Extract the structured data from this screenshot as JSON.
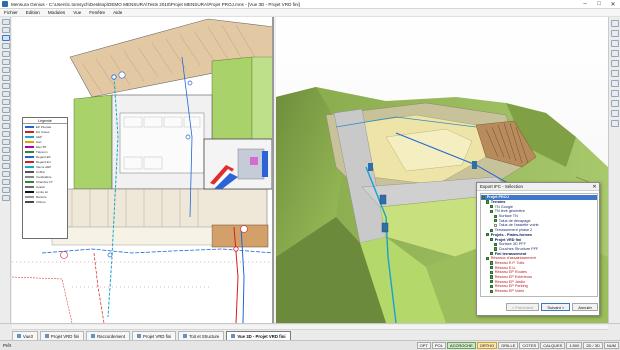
{
  "window": {
    "title": "Mensura Genius - C:\\Users\\c.tomsych\\Desktop\\DEMO MENSURA\\Tests 2018\\Projet MENSURA\\Projet PROJ.mns - [Vue 3D - Projet VRD fini]",
    "min": "–",
    "max": "□",
    "close": "✕"
  },
  "menu": [
    "Fichier",
    "Edition",
    "Modules",
    "Vue",
    "Fenêtre",
    "Aide",
    "Fenêtre"
  ],
  "legend": {
    "title": "Légende",
    "rows": [
      {
        "label": "EP Pluviale",
        "color": "#1e66d6"
      },
      {
        "label": "EU Usées",
        "color": "#d21f1f"
      },
      {
        "label": "AEP",
        "color": "#17a7c9"
      },
      {
        "label": "Gaz",
        "color": "#e0a000"
      },
      {
        "label": "Elec BT",
        "color": "#b000b0"
      },
      {
        "label": "Télécom",
        "color": "#2f8a2f"
      },
      {
        "label": "Regard EP",
        "color": "#1e66d6"
      },
      {
        "label": "Regard EU",
        "color": "#d21f1f"
      },
      {
        "label": "Vanne AEP",
        "color": "#17a7c9"
      },
      {
        "label": "Coffret",
        "color": "#555555"
      },
      {
        "label": "Candélabre",
        "color": "#888888"
      },
      {
        "label": "Chambre FT",
        "color": "#2f8a2f"
      },
      {
        "label": "Avaloir",
        "color": "#6b6b6b"
      },
      {
        "label": "Limite lot",
        "color": "#111111"
      },
      {
        "label": "Bordure",
        "color": "#9a9a9a"
      },
      {
        "label": "Clôture",
        "color": "#4a4a4a"
      }
    ]
  },
  "export_dialog": {
    "title": "Export IFC - Sélection",
    "close": "✕",
    "tree": [
      {
        "label": "Projet PROJ",
        "kind": "head",
        "indent": 0,
        "checked": true
      },
      {
        "label": "Terrains",
        "kind": "grp",
        "indent": 1,
        "checked": true
      },
      {
        "label": "TN Google",
        "kind": "node",
        "indent": 2,
        "checked": true
      },
      {
        "label": "TN levé géomètre",
        "kind": "node",
        "indent": 2,
        "checked": true
      },
      {
        "label": "Surface TN",
        "kind": "node",
        "indent": 3,
        "checked": true
      },
      {
        "label": "Talus de décapage",
        "kind": "node",
        "indent": 3,
        "checked": true
      },
      {
        "label": "Talus de l'assiette voirie",
        "kind": "node",
        "indent": 3,
        "checked": false
      },
      {
        "label": "Terrassement phase 2",
        "kind": "node",
        "indent": 2,
        "checked": true
      },
      {
        "label": "Projets - Plates-formes",
        "kind": "grp",
        "indent": 1,
        "checked": true
      },
      {
        "label": "Projet VRD fini",
        "kind": "grp",
        "indent": 2,
        "checked": true
      },
      {
        "label": "Surface 3D PFF",
        "kind": "node",
        "indent": 3,
        "checked": true
      },
      {
        "label": "Couches Structure PFF",
        "kind": "node",
        "indent": 3,
        "checked": true
      },
      {
        "label": "Fini terrassement",
        "kind": "grp",
        "indent": 2,
        "checked": true
      },
      {
        "label": "Réseaux d'assainissement",
        "kind": "red",
        "indent": 1,
        "checked": true
      },
      {
        "label": "Réseau E.P. Toits",
        "kind": "red",
        "indent": 2,
        "checked": true
      },
      {
        "label": "Réseau E.U.",
        "kind": "red",
        "indent": 2,
        "checked": true
      },
      {
        "label": "Réseau EP Routes",
        "kind": "red",
        "indent": 2,
        "checked": true
      },
      {
        "label": "Réseau EP Extérieurs",
        "kind": "red",
        "indent": 2,
        "checked": true
      },
      {
        "label": "Réseau EP Jardin",
        "kind": "red",
        "indent": 2,
        "checked": true
      },
      {
        "label": "Réseau EP Parking",
        "kind": "red",
        "indent": 2,
        "checked": true
      },
      {
        "label": "Réseau EP Voirie",
        "kind": "red",
        "indent": 2,
        "checked": true
      }
    ],
    "buttons": {
      "previous": "< Précédent",
      "next": "Suivant >",
      "cancel": "Annuler"
    }
  },
  "tabs": [
    {
      "label": "Vue3",
      "active": false
    },
    {
      "label": "Projet VRD fini",
      "active": false
    },
    {
      "label": "Raccordement",
      "active": false
    },
    {
      "label": "Projet VRD fini",
      "active": false
    },
    {
      "label": "Toit et Structure",
      "active": false
    },
    {
      "label": "Vue 3D - Projet VRD fini",
      "active": true
    }
  ],
  "status": {
    "text": "Prêt",
    "buttons": [
      {
        "label": "OPT",
        "state": "off"
      },
      {
        "label": "POL",
        "state": "off"
      },
      {
        "label": "ACCROCHE",
        "state": "on"
      },
      {
        "label": "ORTHO",
        "state": "warn"
      },
      {
        "label": "GRILLE",
        "state": "off"
      },
      {
        "label": "COTES",
        "state": "off"
      },
      {
        "label": "CALQUES",
        "state": "off"
      },
      {
        "label": "1:500",
        "state": "off"
      },
      {
        "label": "2D / 3D",
        "state": "off"
      },
      {
        "label": "NUM",
        "state": "off"
      }
    ]
  },
  "colors": {
    "accent": "#3f78c8",
    "grass": "#8cc63f",
    "platform": "#f2e29a",
    "network_blue": "#1e66d6",
    "network_red": "#d21f1f"
  }
}
